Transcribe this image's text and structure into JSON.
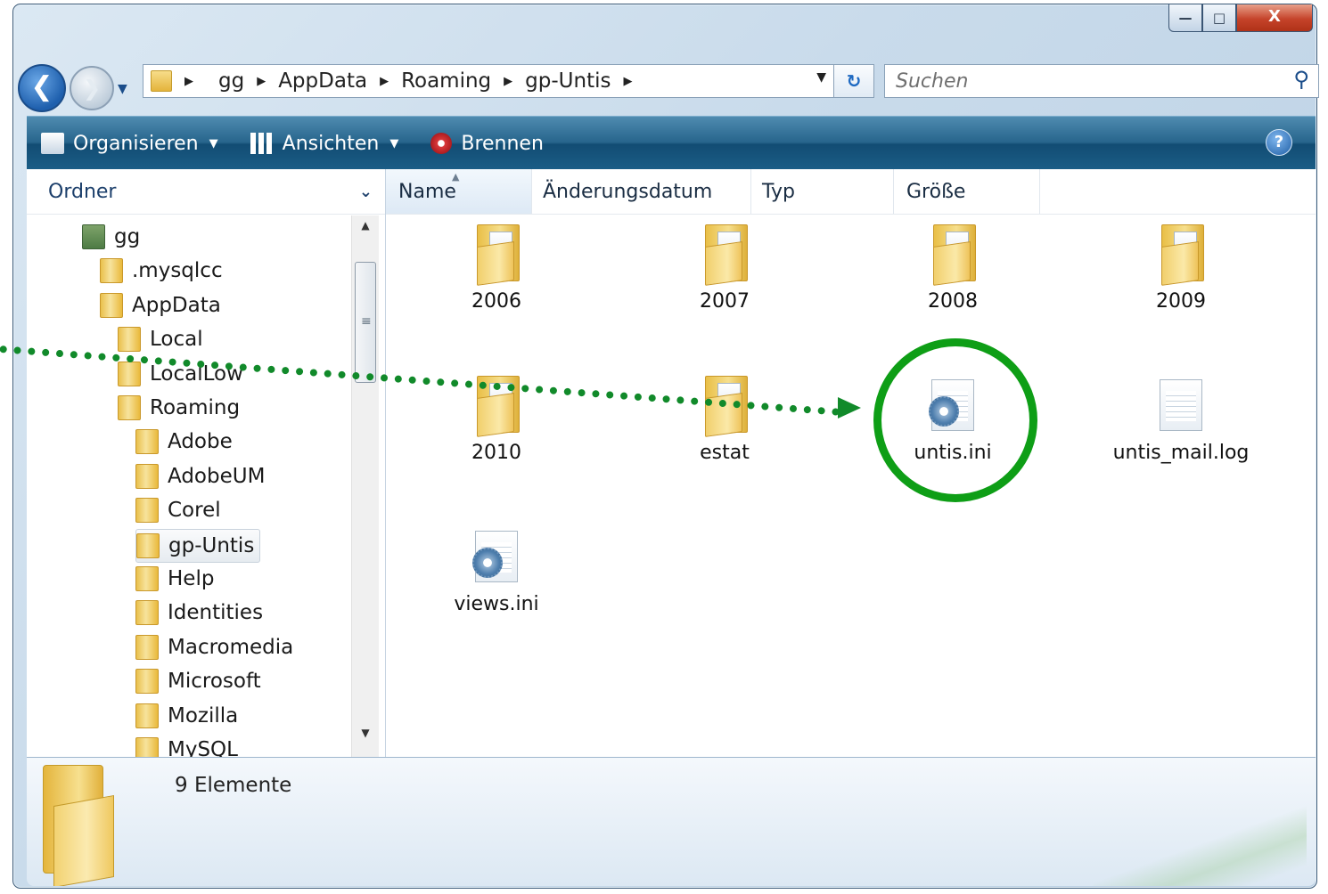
{
  "window": {
    "caption_buttons": {
      "minimize": "—",
      "maximize": "□",
      "close": "X"
    }
  },
  "navigation": {
    "breadcrumbs": [
      "gg",
      "AppData",
      "Roaming",
      "gp-Untis"
    ],
    "search_placeholder": "Suchen"
  },
  "toolbar": {
    "organize_label": "Organisieren",
    "views_label": "Ansichten",
    "burn_label": "Brennen",
    "help_label": "?"
  },
  "folder_pane": {
    "header": "Ordner",
    "tree": [
      {
        "label": "gg",
        "level": 0
      },
      {
        "label": ".mysqlcc",
        "level": 1
      },
      {
        "label": "AppData",
        "level": 1
      },
      {
        "label": "Local",
        "level": 2
      },
      {
        "label": "LocalLow",
        "level": 2
      },
      {
        "label": "Roaming",
        "level": 2
      },
      {
        "label": "Adobe",
        "level": 3
      },
      {
        "label": "AdobeUM",
        "level": 3
      },
      {
        "label": "Corel",
        "level": 3
      },
      {
        "label": "gp-Untis",
        "level": 3,
        "selected": true
      },
      {
        "label": "Help",
        "level": 3
      },
      {
        "label": "Identities",
        "level": 3
      },
      {
        "label": "Macromedia",
        "level": 3
      },
      {
        "label": "Microsoft",
        "level": 3
      },
      {
        "label": "Mozilla",
        "level": 3
      },
      {
        "label": "MySQL",
        "level": 3
      }
    ]
  },
  "file_view": {
    "columns": [
      "Name",
      "Änderungsdatum",
      "Typ",
      "Größe"
    ],
    "items": [
      {
        "label": "2006",
        "kind": "folder"
      },
      {
        "label": "2007",
        "kind": "folder"
      },
      {
        "label": "2008",
        "kind": "folder"
      },
      {
        "label": "2009",
        "kind": "folder"
      },
      {
        "label": "2010",
        "kind": "folder"
      },
      {
        "label": "estat",
        "kind": "folder"
      },
      {
        "label": "untis.ini",
        "kind": "config-file",
        "highlighted": true
      },
      {
        "label": "untis_mail.log",
        "kind": "text-file"
      },
      {
        "label": "views.ini",
        "kind": "config-file"
      }
    ]
  },
  "details": {
    "count_text": "9 Elemente"
  },
  "colors": {
    "annotation_green": "#0e9e16",
    "toolbar_blue": "#1b5e87"
  }
}
